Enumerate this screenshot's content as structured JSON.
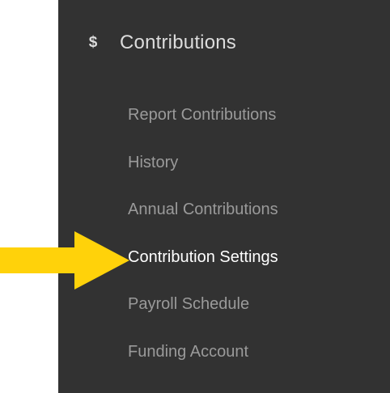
{
  "section": {
    "icon": "dollar-icon",
    "icon_glyph": "$",
    "title": "Contributions"
  },
  "menu": {
    "items": [
      {
        "label": "Report Contributions",
        "active": false
      },
      {
        "label": "History",
        "active": false
      },
      {
        "label": "Annual Contributions",
        "active": false
      },
      {
        "label": "Contribution Settings",
        "active": true
      },
      {
        "label": "Payroll Schedule",
        "active": false
      },
      {
        "label": "Funding Account",
        "active": false
      }
    ]
  },
  "colors": {
    "panel_bg": "#323232",
    "item_text": "#9a9a9a",
    "active_text": "#ffffff",
    "arrow": "#ffd20a"
  }
}
